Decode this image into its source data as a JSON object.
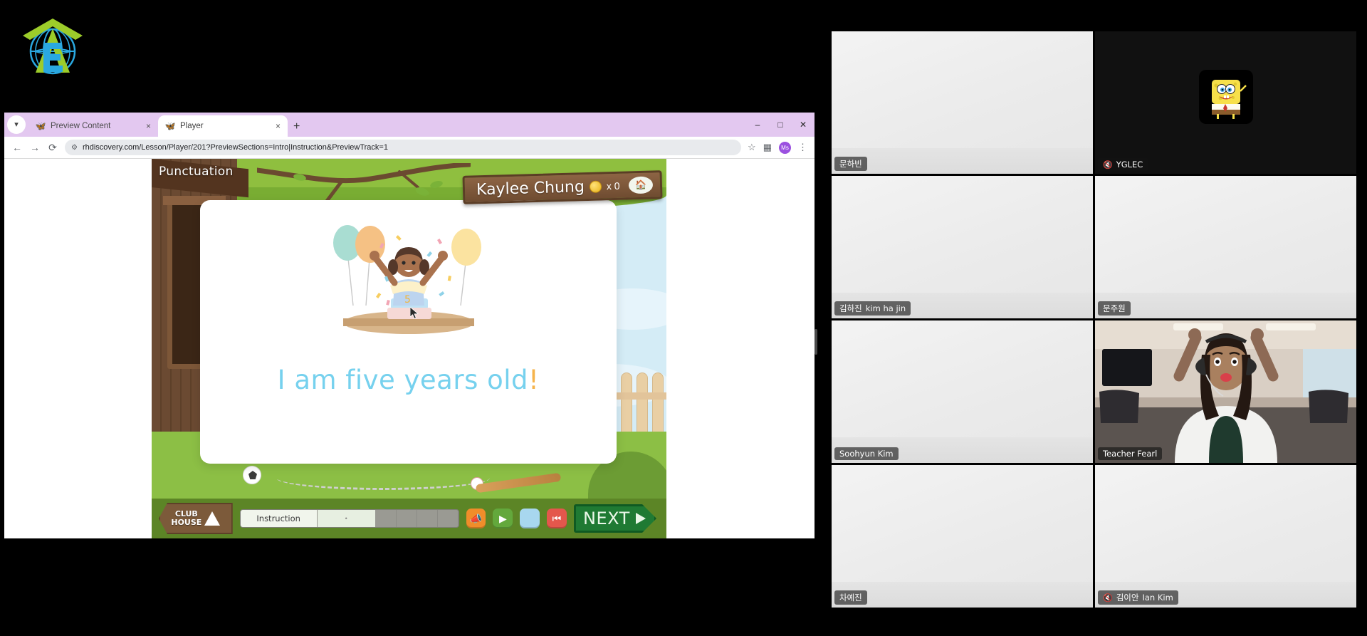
{
  "app": {
    "background_color": "#000000",
    "logo_name": "eye-level-globe-logo"
  },
  "browser": {
    "tab_search_icon": "chevron-down-icon",
    "tabs": [
      {
        "title": "Preview Content",
        "favicon": "butterfly-icon",
        "active": false,
        "close_label": "×"
      },
      {
        "title": "Player",
        "favicon": "butterfly-icon",
        "active": true,
        "close_label": "×"
      }
    ],
    "new_tab_label": "+",
    "window_controls": {
      "minimize": "–",
      "maximize": "□",
      "close": "✕"
    },
    "nav": {
      "back": "←",
      "forward": "→",
      "reload": "⟳"
    },
    "url": "rhdiscovery.com/Lesson/Player/201?PreviewSections=Intro|Instruction&PreviewTrack=1",
    "url_site_icon": "tune-icon",
    "bookmark_icon": "star-icon",
    "extension_icon": "extensions-icon",
    "profile_initials": "Ms",
    "menu_icon": "kebab-menu-icon"
  },
  "player": {
    "section_label": "Punctuation",
    "student_name": "Kaylee Chung",
    "coin_icon": "coin-icon",
    "coin_count": "x 0",
    "house_badge_icon": "treehouse-icon",
    "sentence_text": "I am five years old",
    "sentence_punctuation": "!",
    "sentence_color": "#76d1ee",
    "punctuation_color": "#f6b44c",
    "illustration_name": "birthday-girl-with-cake-and-balloons",
    "toolbar": {
      "clubhouse_line1": "CLUB",
      "clubhouse_line2": "HOUSE",
      "clubhouse_icon": "up-arrow-icon",
      "progress_section_label": "Instruction",
      "controls": [
        {
          "name": "sound-effects-button",
          "icon": "megaphone-icon",
          "color": "#f08d2a",
          "glyph": "📣"
        },
        {
          "name": "play-button",
          "icon": "play-icon",
          "color": "#63a83c",
          "glyph": "▶"
        },
        {
          "name": "blank-button",
          "icon": "blank-icon",
          "color": "#a8d7ef",
          "glyph": ""
        },
        {
          "name": "rewind-button",
          "icon": "rewind-icon",
          "color": "#e4574c",
          "glyph": "⏮"
        }
      ],
      "next_label": "NEXT",
      "next_arrow_icon": "arrow-right-icon"
    }
  },
  "video_conference": {
    "active_speaker_color": "#4ee08a",
    "rows": [
      [
        {
          "name": "문하빈",
          "sub": "",
          "muted": false,
          "video": true,
          "active": false,
          "avatar": ""
        },
        {
          "name": "YGLEC",
          "sub": "",
          "muted": true,
          "video": false,
          "active": false,
          "avatar": "spongebob-avatar"
        }
      ],
      [
        {
          "name": "김하진",
          "sub": "kim ha jin",
          "muted": false,
          "video": true,
          "active": false,
          "avatar": ""
        },
        {
          "name": "문주원",
          "sub": "",
          "muted": false,
          "video": true,
          "active": false,
          "avatar": ""
        }
      ],
      [
        {
          "name": "Soohyun Kim",
          "sub": "",
          "muted": false,
          "video": true,
          "active": false,
          "avatar": ""
        },
        {
          "name": "Teacher Fearl",
          "sub": "",
          "muted": false,
          "video": true,
          "active": true,
          "avatar": ""
        }
      ],
      [
        {
          "name": "차예진",
          "sub": "",
          "muted": false,
          "video": true,
          "active": false,
          "avatar": ""
        },
        {
          "name": "김이안",
          "sub": "Ian Kim",
          "muted": true,
          "video": true,
          "active": false,
          "avatar": ""
        }
      ]
    ]
  }
}
